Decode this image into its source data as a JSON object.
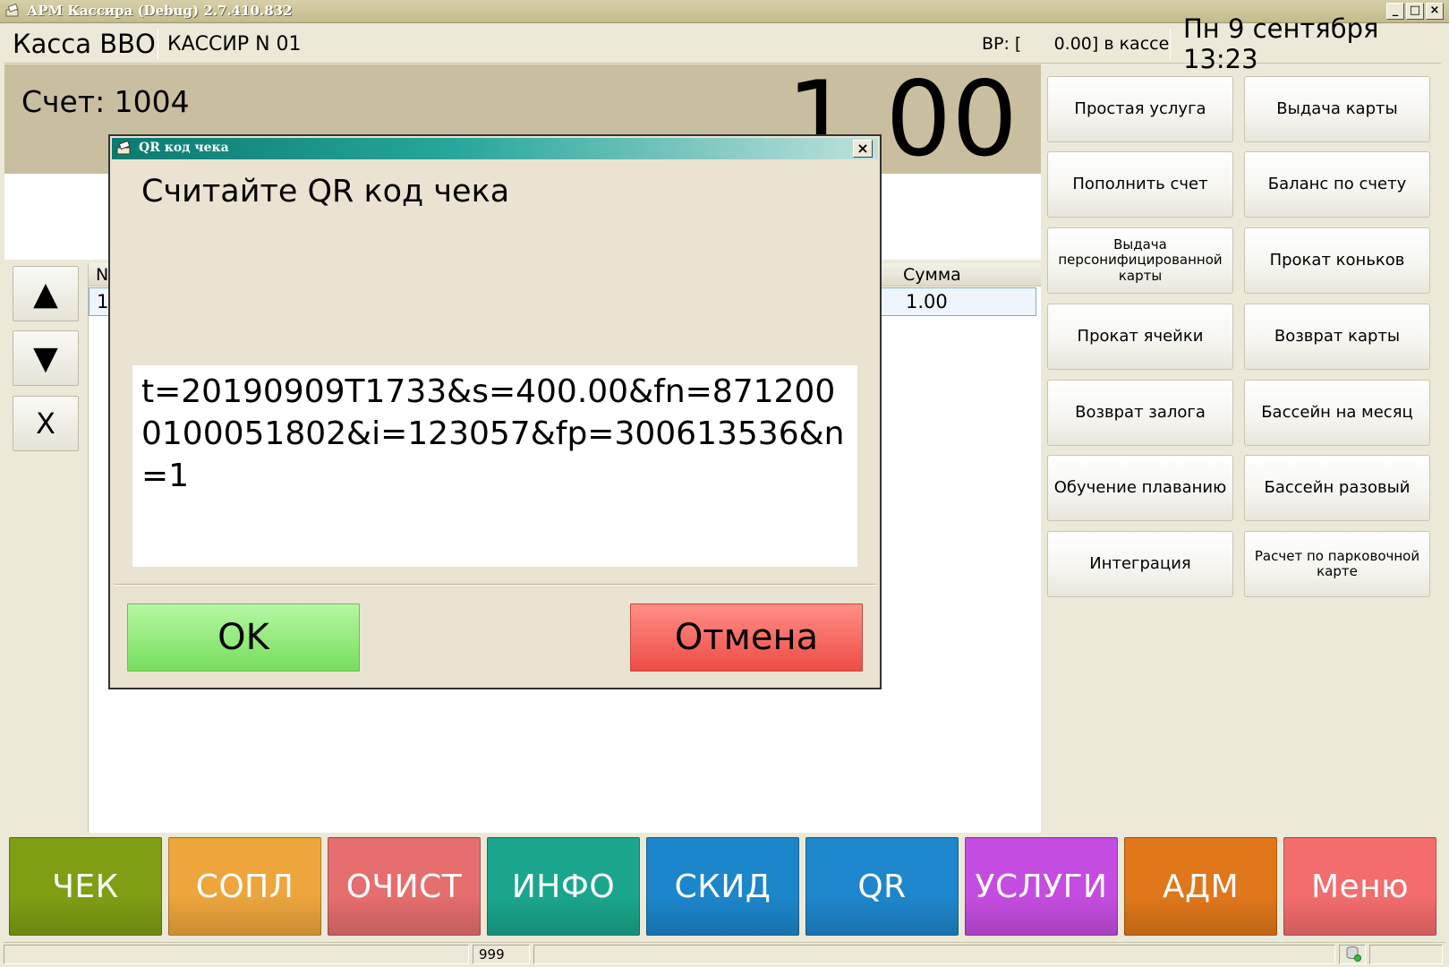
{
  "window": {
    "title": "АРМ Кассира (Debug) 2.7.410.832",
    "controls": [
      "_",
      "□",
      "×"
    ]
  },
  "header": {
    "kassa": "Касса ВВО",
    "cashier": "КАССИР N 01",
    "vr": "ВР: [      0.00] в кассе",
    "datetime": "Пн 9 сентября 13:23"
  },
  "account": {
    "label": "Счет: 1004",
    "total": "1.00"
  },
  "nav": {
    "up": "▲",
    "down": "▼",
    "delete": "X"
  },
  "grid": {
    "columns": [
      "N",
      "Сумма"
    ],
    "rows": [
      {
        "n": "1",
        "sum": "1.00"
      }
    ]
  },
  "services": [
    "Простая услуга",
    "Выдача карты",
    "Пополнить счет",
    "Баланс по счету",
    "Выдача персонифицированной карты",
    "Прокат коньков",
    "Прокат ячейки",
    "Возврат карты",
    "Возврат залога",
    "Бассейн на месяц",
    "Обучение плаванию",
    "Бассейн разовый",
    "Интеграция",
    "Расчет по парковочной карте"
  ],
  "bottom_buttons": [
    {
      "label": "ЧЕК",
      "color": "#7f9e14"
    },
    {
      "label": "СОПЛ",
      "color": "#eda53c"
    },
    {
      "label": "ОЧИСТ",
      "color": "#e66e6e"
    },
    {
      "label": "ИНФО",
      "color": "#1aa68c"
    },
    {
      "label": "СКИД",
      "color": "#1c86cb"
    },
    {
      "label": "QR",
      "color": "#1e86cc"
    },
    {
      "label": "УСЛУГИ",
      "color": "#c54ce0"
    },
    {
      "label": "АДМ",
      "color": "#e0771a"
    },
    {
      "label": "Меню",
      "color": "#f36d6d"
    }
  ],
  "statusbar": {
    "code": "999"
  },
  "dialog": {
    "title": "QR код чека",
    "close": "×",
    "heading": "Считайте QR код чека",
    "qr_value": "t=20190909T1733&s=400.00&fn=8712000100051802&i=123057&fp=300613536&n=1",
    "ok_label": "OK",
    "cancel_label": "Отмена"
  }
}
